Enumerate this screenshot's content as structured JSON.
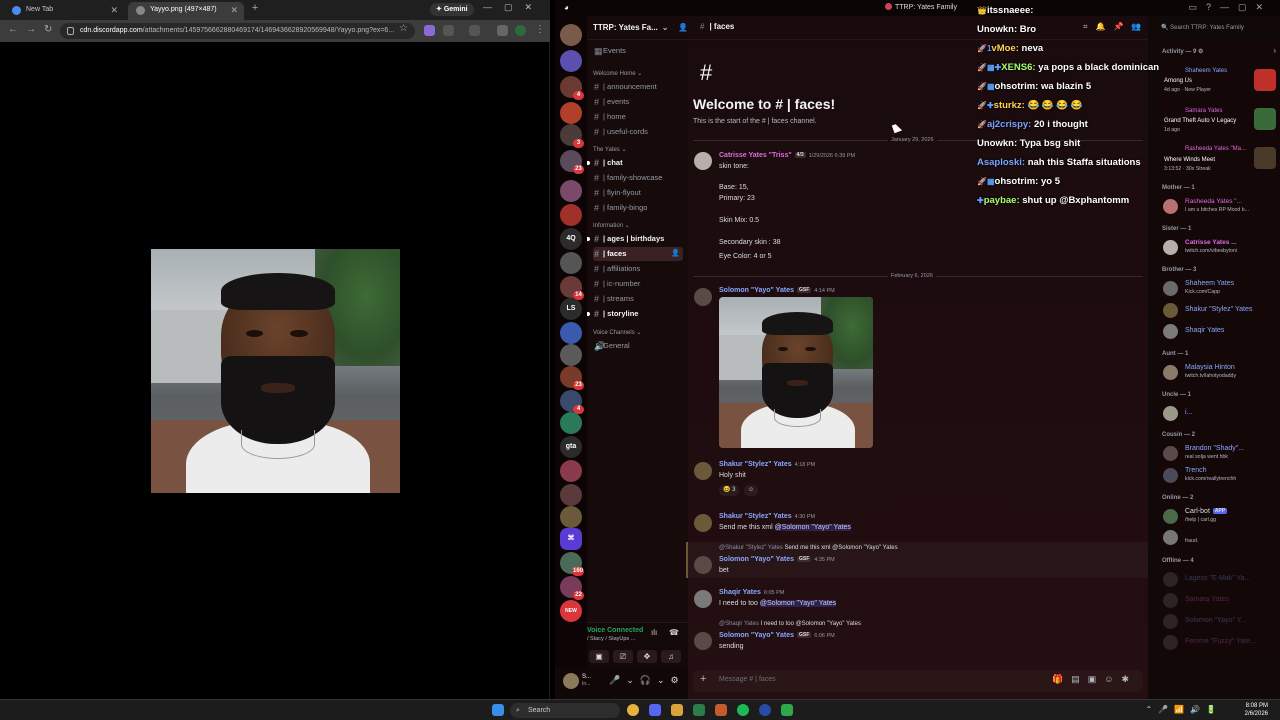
{
  "browser": {
    "tabs": [
      {
        "title": "New Tab"
      },
      {
        "title": "Yayyo.png (497×487)"
      }
    ],
    "gemini_label": "Gemini",
    "url_host": "cdn.discordapp.com",
    "url_path": "/attachments/1459756662880469174/1469436628920569948/Yayyo.png?ex=6..."
  },
  "discord": {
    "window_title": "TTRP: Yates Family",
    "guild_name": "TTRP: Yates Fa...",
    "channel_header": "| faces",
    "events_label": "Events",
    "categories": {
      "welcome_home": "Welcome Home",
      "the_yates": "The Yates",
      "information": "Information",
      "voice_channels": "Voice Channels"
    },
    "channels": [
      {
        "name": "| announcement",
        "bold": false
      },
      {
        "name": "| events",
        "bold": false
      },
      {
        "name": "| home",
        "bold": false
      },
      {
        "name": "| useful-cords",
        "bold": false
      },
      {
        "name": "| chat",
        "bold": true
      },
      {
        "name": "| family-showcase",
        "bold": false
      },
      {
        "name": "| flyin-flyout",
        "bold": false
      },
      {
        "name": "| family-bingo",
        "bold": false
      },
      {
        "name": "| ages | birthdays",
        "bold": true
      },
      {
        "name": "| faces",
        "bold": true
      },
      {
        "name": "| affiliations",
        "bold": false
      },
      {
        "name": "| ic-number",
        "bold": false
      },
      {
        "name": "| streams",
        "bold": false
      },
      {
        "name": "| storyline",
        "bold": true
      }
    ],
    "voice_channel": "General",
    "voice_panel": {
      "status": "Voice Connected",
      "sub": "/ Stacy / StayUps ..."
    },
    "user_panel": {
      "name": "S...",
      "status": "In..."
    },
    "server_labels": [
      "4Q",
      "LS",
      "gta",
      "NEW"
    ],
    "server_badges": [
      "4",
      "3",
      "23",
      "14",
      "23",
      "4",
      "160",
      "22",
      "12"
    ],
    "welcome": {
      "hash": "#",
      "title": "Welcome to # | faces!",
      "subtitle": "This is the start of the # | faces channel."
    },
    "dates": [
      "January 29, 2026",
      "February 6, 2026"
    ],
    "messages": [
      {
        "author": "Catrisse Yates \"Triss\"",
        "tag": "4/3",
        "time": "1/29/2026 6:39 PM",
        "lines": [
          "skin tone:",
          "Base: 15,",
          "Primary: 23",
          "Skin Mix: 0.5",
          "Secondary skin : 38",
          "Eye Color: 4 or 5"
        ]
      },
      {
        "author": "Solomon \"Yayo\" Yates",
        "tag": "GSF",
        "time": "4:14 PM"
      },
      {
        "author": "Shakur \"Stylez\" Yates",
        "time": "4:18 PM",
        "text": "Holy shit",
        "reaction_count": "3"
      },
      {
        "author": "Shakur \"Stylez\" Yates",
        "time": "4:30 PM",
        "text": "Send me this xml ",
        "mention": "@Solomon \"Yayo\" Yates"
      },
      {
        "reply_author": "@Shakur \"Stylez\" Yates",
        "reply_text": "Send me this xml @Solomon \"Yayo\" Yates",
        "author": "Solomon \"Yayo\" Yates",
        "tag": "GSF",
        "time": "4:35 PM",
        "text": "bet"
      },
      {
        "author": "Shaqir Yates",
        "time": "6:05 PM",
        "text": "I need to too ",
        "mention": "@Solomon \"Yayo\" Yates"
      },
      {
        "reply_author": "@Shaqir Yates",
        "reply_text": "I need to too @Solomon \"Yayo\" Yates",
        "author": "Solomon \"Yayo\" Yates",
        "tag": "GSF",
        "time": "6:06 PM",
        "text": "sending"
      }
    ],
    "input_placeholder": "Message # | faces",
    "search_placeholder": "Search TTRP: Yates Family",
    "members": {
      "activity_header": "Activity — 9",
      "activity": [
        {
          "name": "Shaheem Yates",
          "game": "Among Us",
          "detail": "4d ago",
          "detail2": "New Player"
        },
        {
          "name": "Samara Yates",
          "game": "Grand Theft Auto V Legacy",
          "detail": "1d ago"
        },
        {
          "name": "Rasheeda Yates \"Ma...",
          "game": "Where Winds Meet",
          "detail": "3:13:52",
          "detail2": "30x Streak"
        }
      ],
      "groups": [
        {
          "header": "Mother — 1",
          "members": [
            {
              "name": "Rasheeda Yates \"...",
              "sub": "I am u bitches RP Mood b..."
            }
          ]
        },
        {
          "header": "Sister — 1",
          "members": [
            {
              "name": "Catrisse Yates ...",
              "sub": "twitch.com/vibesbytoni"
            }
          ]
        },
        {
          "header": "Brother — 3",
          "members": [
            {
              "name": "Shaheem Yates",
              "sub": "Kick.com/Capp"
            },
            {
              "name": "Shakur \"Stylez\" Yates",
              "sub": ""
            },
            {
              "name": "Shaqir Yates",
              "sub": ""
            }
          ]
        },
        {
          "header": "Aunt — 1",
          "members": [
            {
              "name": "Malaysia Hinton",
              "sub": "twitch.tv/lahotyodaddy"
            }
          ]
        },
        {
          "header": "Uncle — 1",
          "members": [
            {
              "name": "i...",
              "sub": ""
            }
          ]
        },
        {
          "header": "Cousin — 2",
          "members": [
            {
              "name": "Brandon \"Shady\"...",
              "sub": "real solja went hbk"
            },
            {
              "name": "Trench",
              "sub": "kick.com/reallytrenchh"
            }
          ]
        },
        {
          "header": "Online — 2",
          "members": [
            {
              "name": "Carl-bot",
              "sub": "/help | carl.gg",
              "tag": "APP"
            },
            {
              "name": "",
              "sub": "fraud."
            }
          ]
        },
        {
          "header": "Offline — 4",
          "members": [
            {
              "name": "Lagess \"E-Mak\" Ya...",
              "sub": ""
            },
            {
              "name": "Samara Yates",
              "sub": ""
            },
            {
              "name": "Solomon \"Yayo\" Y...",
              "sub": ""
            },
            {
              "name": "Femme \"Fuzzy\" Yate...",
              "sub": ""
            }
          ]
        }
      ]
    }
  },
  "stream_overlay": [
    {
      "user": "itssnaeee:",
      "text": "",
      "color": "#ffffff",
      "prefix": "👑"
    },
    {
      "user": "Unowkn:",
      "text": "Bro",
      "color": "#ffffff",
      "prefix": ""
    },
    {
      "user": "vMoe:",
      "text": "neva",
      "color": "#ffd34d",
      "prefix": "🚀1"
    },
    {
      "user": "XENS6:",
      "text": "ya pops a black dominican",
      "color": "#a6ff6e",
      "prefix": "🚀▦✚"
    },
    {
      "user": "ohsotrim:",
      "text": "wa blazin 5",
      "color": "#ffffff",
      "prefix": "🚀▦"
    },
    {
      "user": "sturkz:",
      "text": "😂 😂 😂 😂",
      "color": "#ffd34d",
      "prefix": "🚀✚"
    },
    {
      "user": "aj2crispy:",
      "text": "20 i thought",
      "color": "#7aa2ff",
      "prefix": "🚀"
    },
    {
      "user": "Unowkn:",
      "text": "Typa bsg shit",
      "color": "#ffffff",
      "prefix": ""
    },
    {
      "user": "Asaploski:",
      "text": "nah this Staffa situations",
      "color": "#7aa2ff",
      "prefix": ""
    },
    {
      "user": "ohsotrim:",
      "text": "yo 5",
      "color": "#ffffff",
      "prefix": "🚀▦"
    },
    {
      "user": "paybae:",
      "text": "shut up @Bxphantomm",
      "color": "#a6ff6e",
      "prefix": "✚"
    }
  ],
  "taskbar": {
    "search": "Search",
    "time": "8:08 PM",
    "date": "2/6/2026"
  },
  "colors": {
    "role_pink": "#e06be0",
    "role_blue": "#8aa8ff",
    "online": "#23a55a",
    "idle": "#f0b232",
    "dnd": "#f23f43"
  }
}
